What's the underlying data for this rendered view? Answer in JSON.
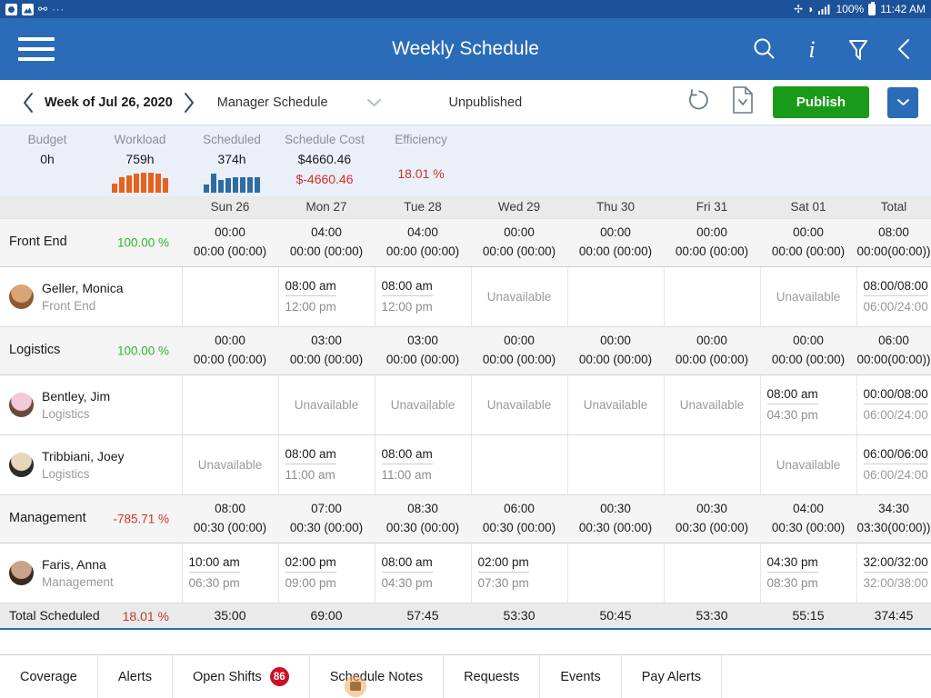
{
  "status_bar": {
    "left_icons": [
      "camera-icon",
      "image-icon",
      "key-icon",
      "overflow-dots"
    ],
    "right_icons": [
      "bluetooth-icon",
      "wifi-icon",
      "signal-icon"
    ],
    "battery_percent": "100%",
    "time": "11:42 AM"
  },
  "app_bar": {
    "menu_icon": "hamburger-icon",
    "title": "Weekly Schedule",
    "actions": [
      "search-icon",
      "info-icon",
      "filter-icon",
      "back-chevron-icon"
    ]
  },
  "sub_bar": {
    "prev_icon": "chevron-left-icon",
    "week_label": "Week of Jul 26, 2020",
    "next_icon": "chevron-right-icon",
    "schedule_select": "Manager Schedule",
    "schedule_caret": "chevron-down-icon",
    "status": "Unpublished",
    "refresh_icon": "undo-refresh-icon",
    "document_icon": "document-download-icon",
    "publish_label": "Publish",
    "publish_caret": "chevron-down-icon",
    "accent_green": "#199b19",
    "accent_blue": "#2b6cb8"
  },
  "metrics": [
    {
      "label": "Budget",
      "value": "0h",
      "value2": "",
      "spark": null
    },
    {
      "label": "Workload",
      "value": "759h",
      "value2": "",
      "spark": {
        "color": "#e8621f",
        "bars": [
          10,
          17,
          19,
          21,
          22,
          22,
          21,
          16
        ]
      }
    },
    {
      "label": "Scheduled",
      "value": "374h",
      "value2": "",
      "spark": {
        "color": "#2e6ca4",
        "bars": [
          9,
          21,
          14,
          16,
          17,
          17,
          17,
          17
        ]
      }
    },
    {
      "label": "Schedule Cost",
      "value": "$4660.46",
      "value2": "$-4660.46",
      "spark": null
    },
    {
      "label": "Efficiency",
      "value": "",
      "percent": "18.01 %",
      "spark": null
    }
  ],
  "grid": {
    "name_header": "",
    "days": [
      "Sun 26",
      "Mon 27",
      "Tue 28",
      "Wed 29",
      "Thu 30",
      "Fri 31",
      "Sat 01"
    ],
    "total_header": "Total",
    "sections": [
      {
        "name": "Front End",
        "percent": "100.00 %",
        "percent_sign": "pos",
        "top": [
          "00:00",
          "04:00",
          "04:00",
          "00:00",
          "00:00",
          "00:00",
          "00:00"
        ],
        "bottom": [
          "00:00 (00:00)",
          "00:00 (00:00)",
          "00:00 (00:00)",
          "00:00 (00:00)",
          "00:00 (00:00)",
          "00:00 (00:00)",
          "00:00 (00:00)"
        ],
        "total_top": "08:00",
        "total_bottom": "00:00(00:00)",
        "employees": [
          {
            "name": "Geller, Monica",
            "role": "Front End",
            "avatar": "avatar-monica",
            "avatar_colors": [
              "#d9a577",
              "#8c5b33"
            ],
            "cells": [
              {
                "type": "empty"
              },
              {
                "type": "shift",
                "in": "08:00 am",
                "out": "12:00 pm"
              },
              {
                "type": "shift",
                "in": "08:00 am",
                "out": "12:00 pm"
              },
              {
                "type": "unavailable",
                "text": "Unavailable"
              },
              {
                "type": "empty"
              },
              {
                "type": "empty"
              },
              {
                "type": "unavailable",
                "text": "Unavailable"
              }
            ],
            "total_a": "08:00/08:00",
            "total_b": "06:00/24:00"
          }
        ]
      },
      {
        "name": "Logistics",
        "percent": "100.00 %",
        "percent_sign": "pos",
        "top": [
          "00:00",
          "03:00",
          "03:00",
          "00:00",
          "00:00",
          "00:00",
          "00:00"
        ],
        "bottom": [
          "00:00 (00:00)",
          "00:00 (00:00)",
          "00:00 (00:00)",
          "00:00 (00:00)",
          "00:00 (00:00)",
          "00:00 (00:00)",
          "00:00 (00:00)"
        ],
        "total_top": "06:00",
        "total_bottom": "00:00(00:00)",
        "employees": [
          {
            "name": "Bentley, Jim",
            "role": "Logistics",
            "avatar": "avatar-jim",
            "avatar_colors": [
              "#f2c9d6",
              "#6b4a3a"
            ],
            "cells": [
              {
                "type": "empty"
              },
              {
                "type": "unavailable",
                "text": "Unavailable"
              },
              {
                "type": "unavailable",
                "text": "Unavailable"
              },
              {
                "type": "unavailable",
                "text": "Unavailable"
              },
              {
                "type": "unavailable",
                "text": "Unavailable"
              },
              {
                "type": "unavailable",
                "text": "Unavailable"
              },
              {
                "type": "shift",
                "in": "08:00 am",
                "out": "04:30 pm"
              }
            ],
            "total_a": "00:00/08:00",
            "total_b": "06:00/24:00"
          },
          {
            "name": "Tribbiani, Joey",
            "role": "Logistics",
            "avatar": "avatar-joey",
            "avatar_colors": [
              "#e8d5c0",
              "#2b2b2b"
            ],
            "cells": [
              {
                "type": "unavailable",
                "text": "Unavailable"
              },
              {
                "type": "shift",
                "in": "08:00 am",
                "out": "11:00 am"
              },
              {
                "type": "shift",
                "in": "08:00 am",
                "out": "11:00 am"
              },
              {
                "type": "empty"
              },
              {
                "type": "empty"
              },
              {
                "type": "empty"
              },
              {
                "type": "unavailable",
                "text": "Unavailable"
              }
            ],
            "total_a": "06:00/06:00",
            "total_b": "06:00/24:00"
          }
        ]
      },
      {
        "name": "Management",
        "percent": "-785.71 %",
        "percent_sign": "neg",
        "top": [
          "08:00",
          "07:00",
          "08:30",
          "06:00",
          "00:30",
          "00:30",
          "04:00"
        ],
        "bottom": [
          "00:30 (00:00)",
          "00:30 (00:00)",
          "00:30 (00:00)",
          "00:30 (00:00)",
          "00:30 (00:00)",
          "00:30 (00:00)",
          "00:30 (00:00)"
        ],
        "total_top": "34:30",
        "total_bottom": "03:30(00:00)",
        "employees": [
          {
            "name": "Faris, Anna",
            "role": "Management",
            "avatar": "avatar-anna",
            "avatar_colors": [
              "#c9a48a",
              "#3a2a24"
            ],
            "cells": [
              {
                "type": "shift",
                "in": "10:00 am",
                "out": "06:30 pm"
              },
              {
                "type": "shift",
                "in": "02:00 pm",
                "out": "09:00 pm"
              },
              {
                "type": "shift",
                "in": "08:00 am",
                "out": "04:30 pm"
              },
              {
                "type": "shift",
                "in": "02:00 pm",
                "out": "07:30 pm"
              },
              {
                "type": "empty"
              },
              {
                "type": "empty"
              },
              {
                "type": "shift",
                "in": "04:30 pm",
                "out": "08:30 pm"
              }
            ],
            "total_a": "32:00/32:00",
            "total_b": "32:00/38:00"
          }
        ]
      }
    ],
    "total_row": {
      "label": "Total Scheduled",
      "percent": "18.01 %",
      "values": [
        "35:00",
        "69:00",
        "57:45",
        "53:30",
        "50:45",
        "53:30",
        "55:15"
      ],
      "total": "374:45"
    }
  },
  "tabs": [
    {
      "label": "Coverage",
      "badge": ""
    },
    {
      "label": "Alerts",
      "badge": ""
    },
    {
      "label": "Open Shifts",
      "badge": "86"
    },
    {
      "label": "Schedule Notes",
      "badge": ""
    },
    {
      "label": "Requests",
      "badge": ""
    },
    {
      "label": "Events",
      "badge": ""
    },
    {
      "label": "Pay Alerts",
      "badge": ""
    }
  ]
}
